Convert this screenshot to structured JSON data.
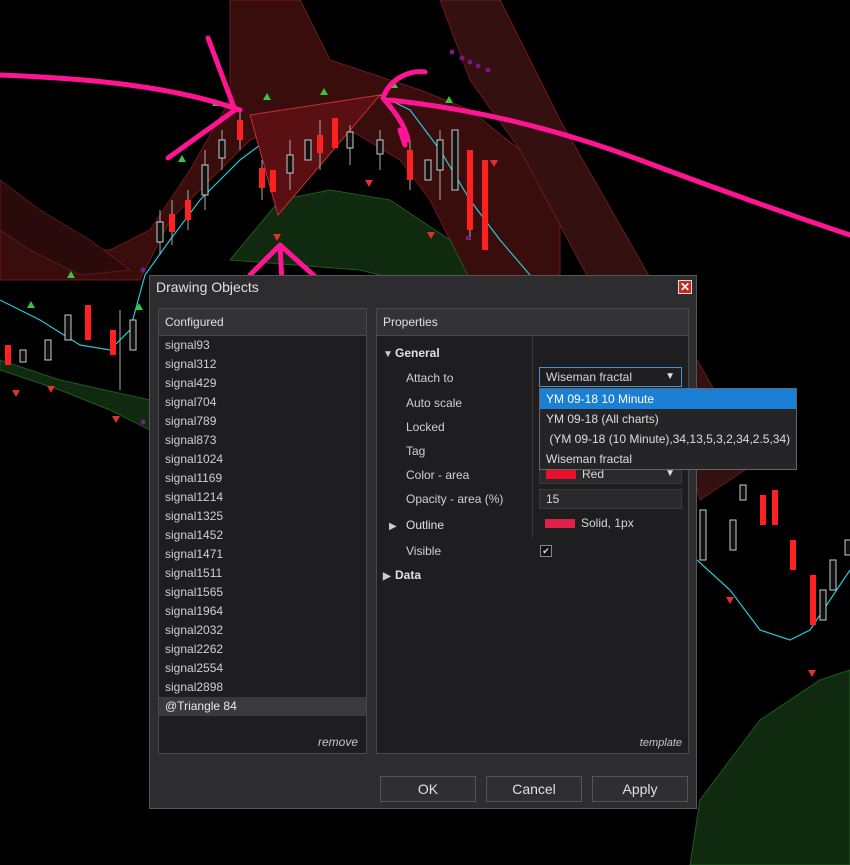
{
  "dialog": {
    "title": "Drawing Objects",
    "close_glyph": "✕",
    "configured_header": "Configured",
    "configured_items": [
      "signal93",
      "signal312",
      "signal429",
      "signal704",
      "signal789",
      "signal873",
      "signal1024",
      "signal1169",
      "signal1214",
      "signal1325",
      "signal1452",
      "signal1471",
      "signal1511",
      "signal1565",
      "signal1964",
      "signal2032",
      "signal2262",
      "signal2554",
      "signal2898",
      "@Triangle 84"
    ],
    "remove_label": "remove",
    "properties_header": "Properties",
    "general_label": "General",
    "data_label": "Data",
    "props": {
      "attach_to_label": "Attach to",
      "attach_to_value": "Wiseman fractal",
      "auto_scale_label": "Auto scale",
      "locked_label": "Locked",
      "tag_label": "Tag",
      "color_area_label": "Color - area",
      "color_area_value": "Red",
      "opacity_label": "Opacity - area (%)",
      "opacity_value": "15",
      "outline_label": "Outline",
      "outline_value": "Solid, 1px",
      "visible_label": "Visible",
      "visible_check": "✔"
    },
    "template_label": "template",
    "ok_label": "OK",
    "cancel_label": "Cancel",
    "apply_label": "Apply",
    "dropdown_options": [
      "YM 09-18 10 Minute",
      "YM 09-18 (All charts)",
      " (YM 09-18 (10 Minute),34,13,5,3,2,34,2.5,34)",
      "Wiseman fractal"
    ]
  },
  "colors": {
    "accent": "#1c7fd6",
    "outline_swatch": "#e0224a",
    "area_swatch": "#e8102a",
    "annotation": "#ff1493"
  }
}
